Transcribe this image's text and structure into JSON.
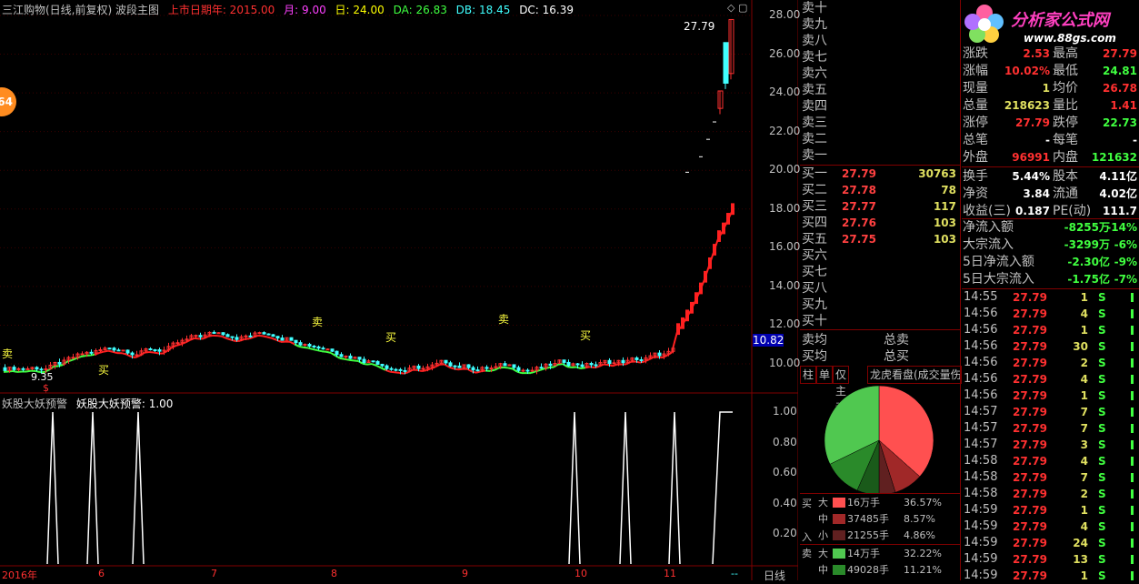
{
  "header": {
    "title": "三江购物(日线,前复权) 波段主图",
    "date_label": "上市日期年: 2015.00",
    "month_label": "月: 9.00",
    "day_label": "日: 24.00",
    "da_label": "DA: 26.83",
    "db_label": "DB: 18.45",
    "dc_label": "DC: 16.39"
  },
  "badge": {
    "value": "64"
  },
  "price_axis": [
    "28.00",
    "26.00",
    "24.00",
    "22.00",
    "20.00",
    "18.00",
    "16.00",
    "14.00",
    "12.00",
    "10.00"
  ],
  "current_price_tag": "10.82",
  "chart_annotations": {
    "high_label": "27.79",
    "low_label": "9.35",
    "sell_1": "卖",
    "sell_2": "卖",
    "sell_3": "卖",
    "buy_1": "买",
    "buy_2": "买",
    "buy_3": "买",
    "dollar_mark": "$"
  },
  "indicator": {
    "title": "妖股大妖预警",
    "value_label": "妖股大妖预警: 1.00",
    "axis": [
      "1.00",
      "0.80",
      "0.60",
      "0.40",
      "0.20"
    ]
  },
  "time_axis": [
    "2016年",
    "6",
    "7",
    "8",
    "9",
    "10",
    "11",
    "--"
  ],
  "period_label": "日线",
  "sell_book": [
    "卖十",
    "卖九",
    "卖八",
    "卖七",
    "卖六",
    "卖五",
    "卖四",
    "卖三",
    "卖二",
    "卖一"
  ],
  "buy_book": [
    {
      "label": "买一",
      "price": "27.79",
      "vol": "30763"
    },
    {
      "label": "买二",
      "price": "27.78",
      "vol": "78"
    },
    {
      "label": "买三",
      "price": "27.77",
      "vol": "117"
    },
    {
      "label": "买四",
      "price": "27.76",
      "vol": "103"
    },
    {
      "label": "买五",
      "price": "27.75",
      "vol": "103"
    },
    {
      "label": "买六",
      "price": "",
      "vol": ""
    },
    {
      "label": "买七",
      "price": "",
      "vol": ""
    },
    {
      "label": "买八",
      "price": "",
      "vol": ""
    },
    {
      "label": "买九",
      "price": "",
      "vol": ""
    },
    {
      "label": "买十",
      "price": "",
      "vol": ""
    }
  ],
  "avg": {
    "sell_avg": "卖均",
    "buy_avg": "买均",
    "total_sell": "总卖",
    "total_buy": "总买"
  },
  "tabs": [
    "柱",
    "单",
    "仅主动",
    "龙虎看盘(成交量伤"
  ],
  "pie": {
    "buy_large": 36.57,
    "buy_mid": 8.57,
    "buy_small": 4.86,
    "sell_large": 32.22,
    "sell_mid": 11.21,
    "sell_small": 6.57,
    "colors": {
      "buy_large": "#ff5050",
      "buy_mid": "#a02828",
      "buy_small": "#602020",
      "sell_large": "#50c850",
      "sell_mid": "#2a8a2a",
      "sell_small": "#1a5a1a"
    }
  },
  "flow": {
    "buy_in": "买",
    "in_label": "入",
    "sell_out": "卖",
    "rows": [
      {
        "size": "大",
        "amount": "16万手",
        "pct": "36.57%"
      },
      {
        "size": "中",
        "amount": "37485手",
        "pct": "8.57%"
      },
      {
        "size": "小",
        "amount": "21255手",
        "pct": "4.86%"
      },
      {
        "size": "大",
        "amount": "14万手",
        "pct": "32.22%"
      },
      {
        "size": "中",
        "amount": "49028手",
        "pct": "11.21%"
      }
    ]
  },
  "logo": {
    "name": "分析家公式网",
    "url": "www.88gs.com"
  },
  "stats": [
    {
      "k1": "涨跌",
      "v1": "2.53",
      "k2": "最高",
      "v2": "27.79"
    },
    {
      "k1": "涨幅",
      "v1": "10.02%",
      "k2": "最低",
      "v2": "24.81"
    },
    {
      "k1": "现量",
      "v1": "1",
      "k2": "均价",
      "v2": "26.78"
    },
    {
      "k1": "总量",
      "v1": "218623",
      "k2": "量比",
      "v2": "1.41"
    },
    {
      "k1": "涨停",
      "v1": "27.79",
      "k2": "跌停",
      "v2": "22.73"
    },
    {
      "k1": "总笔",
      "v1": "-",
      "k2": "每笔",
      "v2": "-"
    },
    {
      "k1": "外盘",
      "v1": "96991",
      "k2": "内盘",
      "v2": "121632"
    },
    {
      "k1": "换手",
      "v1": "5.44%",
      "k2": "股本",
      "v2": "4.11亿"
    },
    {
      "k1": "净资",
      "v1": "3.84",
      "k2": "流通",
      "v2": "4.02亿"
    },
    {
      "k1": "收益(三)",
      "v1": "0.187",
      "k2": "PE(动)",
      "v2": "111.7"
    }
  ],
  "money_flow": [
    {
      "k": "净流入额",
      "v": "-8255万",
      "p": "-14%"
    },
    {
      "k": "大宗流入",
      "v": "-3299万",
      "p": "-6%"
    },
    {
      "k": "5日净流入额",
      "v": "-2.30亿",
      "p": "-9%"
    },
    {
      "k": "5日大宗流入",
      "v": "-1.75亿",
      "p": "-7%"
    }
  ],
  "ticks": [
    {
      "t": "14:55",
      "p": "27.79",
      "v": "1",
      "s": "S"
    },
    {
      "t": "14:56",
      "p": "27.79",
      "v": "4",
      "s": "S"
    },
    {
      "t": "14:56",
      "p": "27.79",
      "v": "1",
      "s": "S"
    },
    {
      "t": "14:56",
      "p": "27.79",
      "v": "30",
      "s": "S"
    },
    {
      "t": "14:56",
      "p": "27.79",
      "v": "2",
      "s": "S"
    },
    {
      "t": "14:56",
      "p": "27.79",
      "v": "4",
      "s": "S"
    },
    {
      "t": "14:56",
      "p": "27.79",
      "v": "1",
      "s": "S"
    },
    {
      "t": "14:57",
      "p": "27.79",
      "v": "7",
      "s": "S"
    },
    {
      "t": "14:57",
      "p": "27.79",
      "v": "7",
      "s": "S"
    },
    {
      "t": "14:57",
      "p": "27.79",
      "v": "3",
      "s": "S"
    },
    {
      "t": "14:58",
      "p": "27.79",
      "v": "4",
      "s": "S"
    },
    {
      "t": "14:58",
      "p": "27.79",
      "v": "7",
      "s": "S"
    },
    {
      "t": "14:58",
      "p": "27.79",
      "v": "2",
      "s": "S"
    },
    {
      "t": "14:59",
      "p": "27.79",
      "v": "1",
      "s": "S"
    },
    {
      "t": "14:59",
      "p": "27.79",
      "v": "4",
      "s": "S"
    },
    {
      "t": "14:59",
      "p": "27.79",
      "v": "24",
      "s": "S"
    },
    {
      "t": "14:59",
      "p": "27.79",
      "v": "13",
      "s": "S"
    },
    {
      "t": "14:59",
      "p": "27.79",
      "v": "1",
      "s": "S"
    }
  ]
}
